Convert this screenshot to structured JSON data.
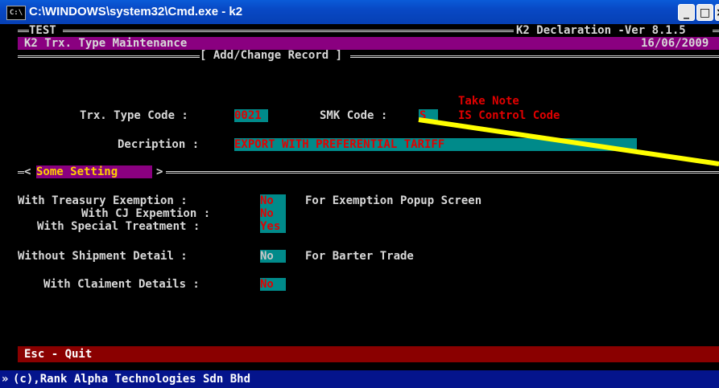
{
  "window": {
    "title": "C:\\WINDOWS\\system32\\Cmd.exe - k2",
    "icon_text": "C:\\",
    "minimize_glyph": "_",
    "maximize_glyph": "□",
    "close_glyph": "×"
  },
  "header": {
    "env": "TEST",
    "app_version": "K2 Declaration -Ver 8.1.5",
    "screen_title": "K2 Trx. Type Maintenance",
    "date": "16/06/2009",
    "mode_title": "[ Add/Change Record ]"
  },
  "form": {
    "trx_type_code_label": "Trx. Type Code :",
    "trx_type_code_value": "0021",
    "smk_code_label": "SMK Code :",
    "smk_code_value": "S",
    "take_note": "Take Note",
    "is_control_code": "IS Control Code",
    "description_label": "Decription :",
    "description_value": "EXPORT WITH PREFERENTIAL TARIFF"
  },
  "section": {
    "left_bracket": "<",
    "title": "Some Setting",
    "right_bracket": ">"
  },
  "settings": {
    "treasury_label": "With Treasury Exemption :",
    "treasury_value": "No",
    "exemption_note": "For Exemption Popup Screen",
    "cj_label": "With CJ Expemtion :",
    "cj_value": "No",
    "special_label": "With Special Treatment :",
    "special_value": "Yes",
    "shipment_label": "Without Shipment Detail :",
    "shipment_value": "No",
    "barter_note": "For Barter Trade",
    "claiment_label": "With Claiment Details :",
    "claiment_value": "No"
  },
  "footer": {
    "quit_label": "Esc - Quit"
  },
  "status": {
    "arrow": "»",
    "copyright": "(c),Rank Alpha Technologies Sdn Bhd"
  },
  "colors": {
    "header_bg": "#8a0080",
    "field_bg": "#008a8a",
    "highlight_red": "#e00000",
    "footer_bg": "#8a0000",
    "annotation_arrow": "#ffff00"
  }
}
